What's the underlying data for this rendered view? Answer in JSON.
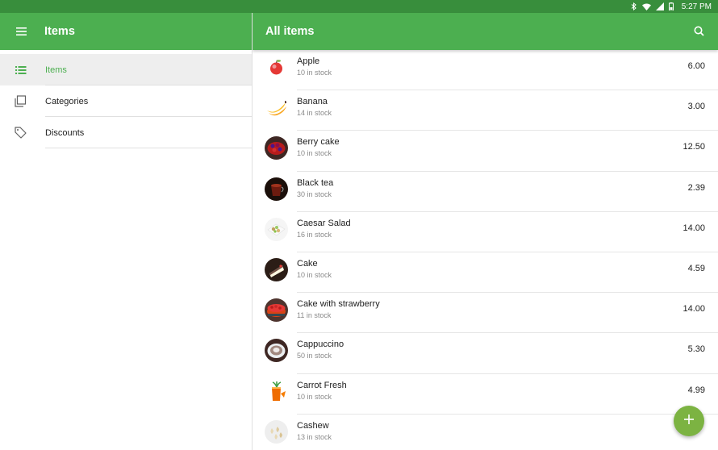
{
  "status_bar": {
    "time": "5:27 PM"
  },
  "left_appbar": {
    "title": "Items"
  },
  "right_appbar": {
    "title": "All items"
  },
  "nav": {
    "items": [
      {
        "label": "Items",
        "icon": "list-icon",
        "active": true
      },
      {
        "label": "Categories",
        "icon": "copy-icon",
        "active": false
      },
      {
        "label": "Discounts",
        "icon": "tag-icon",
        "active": false
      }
    ]
  },
  "items": [
    {
      "name": "Apple",
      "stock": "10 in stock",
      "price": "6.00",
      "thumb": "apple"
    },
    {
      "name": "Banana",
      "stock": "14 in stock",
      "price": "3.00",
      "thumb": "banana"
    },
    {
      "name": "Berry cake",
      "stock": "10 in stock",
      "price": "12.50",
      "thumb": "berry-cake"
    },
    {
      "name": "Black tea",
      "stock": "30 in stock",
      "price": "2.39",
      "thumb": "black-tea"
    },
    {
      "name": "Caesar Salad",
      "stock": "16 in stock",
      "price": "14.00",
      "thumb": "salad"
    },
    {
      "name": "Cake",
      "stock": "10 in stock",
      "price": "4.59",
      "thumb": "cake"
    },
    {
      "name": "Cake with strawberry",
      "stock": "11 in stock",
      "price": "14.00",
      "thumb": "strawberry-cake"
    },
    {
      "name": "Cappuccino",
      "stock": "50 in stock",
      "price": "5.30",
      "thumb": "cappuccino"
    },
    {
      "name": "Carrot Fresh",
      "stock": "10 in stock",
      "price": "4.99",
      "thumb": "carrot-fresh"
    },
    {
      "name": "Cashew",
      "stock": "13 in stock",
      "price": "",
      "thumb": "cashew"
    }
  ],
  "colors": {
    "appbar": "#4caf50",
    "status_bar": "#388e3c",
    "accent": "#4caf50",
    "fab": "#7cb342"
  }
}
